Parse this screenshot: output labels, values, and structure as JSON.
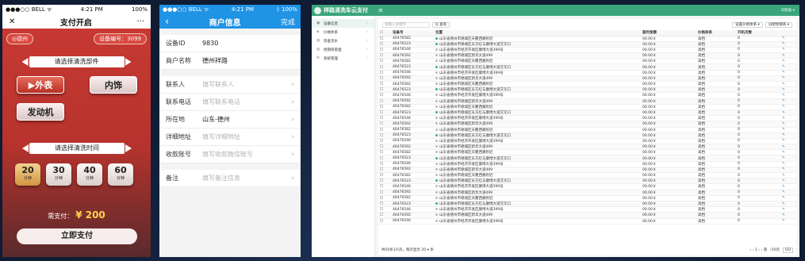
{
  "phone1": {
    "status": {
      "carrier": "●●●○○ BELL ᯤ",
      "time": "4:21 PM",
      "battery": "100%"
    },
    "nav": {
      "close": "✕",
      "title": "支付开启",
      "more": "···"
    },
    "location": "◎德州",
    "device_no": "设备编号：3099",
    "parts_title": "请选择清洗部件",
    "parts": [
      {
        "label": "外表",
        "active": true
      },
      {
        "label": "内饰",
        "active": false
      },
      {
        "label": "发动机",
        "active": false
      }
    ],
    "time_title": "请选择清洗时间",
    "times": [
      {
        "value": "20",
        "unit": "分钟",
        "active": true
      },
      {
        "value": "30",
        "unit": "分钟",
        "active": false
      },
      {
        "value": "40",
        "unit": "分钟",
        "active": false
      },
      {
        "value": "60",
        "unit": "分钟",
        "active": false
      }
    ],
    "pay_label": "需支付：",
    "pay_amount": "¥ 200",
    "pay_button": "立即支付"
  },
  "phone2": {
    "status": {
      "carrier": "●●●○○ BELL ᯤ",
      "time": "4:21 PM",
      "battery": "ᛒ 100%"
    },
    "nav": {
      "back": "‹",
      "title": "商户信息",
      "done": "完成"
    },
    "group1": [
      {
        "label": "设备ID",
        "value": "9830",
        "placeholder": false
      },
      {
        "label": "商户名称",
        "value": "德州祥路",
        "placeholder": false
      }
    ],
    "group2": [
      {
        "label": "联系人",
        "value": "填写联系人",
        "placeholder": true
      },
      {
        "label": "联系电话",
        "value": "填写联系电话",
        "placeholder": true
      },
      {
        "label": "所在地",
        "value": "山东-德州",
        "placeholder": false
      },
      {
        "label": "详细地址",
        "value": "填写详细地址",
        "placeholder": true
      },
      {
        "label": "收款账号",
        "value": "填写收款微信账号",
        "placeholder": true
      }
    ],
    "group3": [
      {
        "label": "备注",
        "value": "填写备注信息",
        "placeholder": true
      }
    ],
    "arrow": "›"
  },
  "admin": {
    "logo": "祥路清洗车云支付",
    "hamburger": "≡",
    "user": "日程表 ▾",
    "sidebar": [
      {
        "icon": "▣",
        "label": "设备信息",
        "active": true
      },
      {
        "icon": "◈",
        "label": "价格体系",
        "active": false
      },
      {
        "icon": "▤",
        "label": "资金流水",
        "active": false
      },
      {
        "icon": "▥",
        "label": "经销商管理",
        "active": false
      },
      {
        "icon": "⚙",
        "label": "系统管理",
        "active": false
      }
    ],
    "chevron": "›",
    "search_placeholder": "请输入关键字",
    "search_button": "Q 查询",
    "btn_right1": "设置价格体系 ▾",
    "btn_right2": "分配经销商 ▾",
    "columns": [
      "",
      "设备号",
      "位置",
      "盈利金额",
      "价格体系",
      "开机次数",
      ""
    ],
    "rows": [
      {
        "id": "46476582",
        "loc": "山东省德州市德城区天衢西路附近",
        "on": true,
        "amt": "00.00￥",
        "price": "高档",
        "count": "0"
      },
      {
        "id": "46476523",
        "loc": "山东省德州市德城区东方红与康博大道交叉口",
        "on": true,
        "amt": "00.00￥",
        "price": "高档",
        "count": "0"
      },
      {
        "id": "46476546",
        "loc": "山东省德州市经济开发区康博大道399号",
        "on": false,
        "amt": "00.00￥",
        "price": "高档",
        "count": "0"
      },
      {
        "id": "46476592",
        "loc": "山东省德州市德城区新华大道499",
        "on": false,
        "amt": "00.00￥",
        "price": "高档",
        "count": "0"
      },
      {
        "id": "46476582",
        "loc": "山东省德州市德城区天衢西路附近",
        "on": false,
        "amt": "00.00￥",
        "price": "高档",
        "count": "0"
      },
      {
        "id": "46476523",
        "loc": "山东省德州市德城区东方红与康博大道交叉口",
        "on": true,
        "amt": "00.00￥",
        "price": "高档",
        "count": "0"
      },
      {
        "id": "46476546",
        "loc": "山东省德州市经济开发区康博大道399号",
        "on": false,
        "amt": "00.00￥",
        "price": "高档",
        "count": "0"
      },
      {
        "id": "46476592",
        "loc": "山东省德州市德城区新华大道499",
        "on": false,
        "amt": "00.00￥",
        "price": "高档",
        "count": "0"
      },
      {
        "id": "46476582",
        "loc": "山东省德州市德城区天衢西路附近",
        "on": false,
        "amt": "00.00￥",
        "price": "高档",
        "count": "0"
      },
      {
        "id": "46476523",
        "loc": "山东省德州市德城区东方红与康博大道交叉口",
        "on": true,
        "amt": "00.00￥",
        "price": "高档",
        "count": "0"
      },
      {
        "id": "46476546",
        "loc": "山东省德州市经济开发区康博大道399号",
        "on": false,
        "amt": "00.00￥",
        "price": "高档",
        "count": "0"
      },
      {
        "id": "46476592",
        "loc": "山东省德州市德城区新华大道499",
        "on": false,
        "amt": "00.00￥",
        "price": "高档",
        "count": "0"
      },
      {
        "id": "46476582",
        "loc": "山东省德州市德城区天衢西路附近",
        "on": false,
        "amt": "00.00￥",
        "price": "高档",
        "count": "0"
      },
      {
        "id": "46476523",
        "loc": "山东省德州市德城区东方红与康博大道交叉口",
        "on": true,
        "amt": "00.00￥",
        "price": "高档",
        "count": "0"
      },
      {
        "id": "46476546",
        "loc": "山东省德州市经济开发区康博大道399号",
        "on": false,
        "amt": "00.00￥",
        "price": "高档",
        "count": "0"
      },
      {
        "id": "46476592",
        "loc": "山东省德州市德城区新华大道499",
        "on": false,
        "amt": "00.00￥",
        "price": "高档",
        "count": "0"
      },
      {
        "id": "46476582",
        "loc": "山东省德州市德城区天衢西路附近",
        "on": false,
        "amt": "00.00￥",
        "price": "高档",
        "count": "0"
      },
      {
        "id": "46476523",
        "loc": "山东省德州市德城区东方红与康博大道交叉口",
        "on": true,
        "amt": "00.00￥",
        "price": "高档",
        "count": "0"
      },
      {
        "id": "46476546",
        "loc": "山东省德州市经济开发区康博大道399号",
        "on": false,
        "amt": "00.00￥",
        "price": "高档",
        "count": "0"
      },
      {
        "id": "46476592",
        "loc": "山东省德州市德城区新华大道499",
        "on": false,
        "amt": "00.00￥",
        "price": "高档",
        "count": "0"
      },
      {
        "id": "46476582",
        "loc": "山东省德州市德城区天衢西路附近",
        "on": false,
        "amt": "00.00￥",
        "price": "高档",
        "count": "0"
      },
      {
        "id": "46476523",
        "loc": "山东省德州市德城区东方红与康博大道交叉口",
        "on": true,
        "amt": "00.00￥",
        "price": "高档",
        "count": "0"
      },
      {
        "id": "46476546",
        "loc": "山东省德州市经济开发区康博大道399号",
        "on": false,
        "amt": "00.00￥",
        "price": "高档",
        "count": "0"
      },
      {
        "id": "46476592",
        "loc": "山东省德州市德城区新华大道499",
        "on": false,
        "amt": "00.00￥",
        "price": "高档",
        "count": "0"
      },
      {
        "id": "46476582",
        "loc": "山东省德州市德城区天衢西路附近",
        "on": false,
        "amt": "00.00￥",
        "price": "高档",
        "count": "0"
      },
      {
        "id": "46476523",
        "loc": "山东省德州市德城区东方红与康博大道交叉口",
        "on": true,
        "amt": "00.00￥",
        "price": "高档",
        "count": "0"
      },
      {
        "id": "46476546",
        "loc": "山东省德州市经济开发区康博大道399号",
        "on": false,
        "amt": "00.00￥",
        "price": "高档",
        "count": "0"
      },
      {
        "id": "46476592",
        "loc": "山东省德州市德城区新华大道499",
        "on": false,
        "amt": "00.00￥",
        "price": "高档",
        "count": "0"
      },
      {
        "id": "46476582",
        "loc": "山东省德州市德城区天衢西路附近",
        "on": false,
        "amt": "00.00￥",
        "price": "高档",
        "count": "0"
      },
      {
        "id": "46476523",
        "loc": "山东省德州市德城区东方红与康博大道交叉口",
        "on": true,
        "amt": "00.00￥",
        "price": "高档",
        "count": "0"
      },
      {
        "id": "46476546",
        "loc": "山东省德州市经济开发区康博大道399号",
        "on": false,
        "amt": "00.00￥",
        "price": "高档",
        "count": "0"
      },
      {
        "id": "46476592",
        "loc": "山东省德州市德城区新华大道499",
        "on": false,
        "amt": "00.00￥",
        "price": "高档",
        "count": "0"
      },
      {
        "id": "46476546",
        "loc": "山东省德州市经济开发区康博大道399号",
        "on": false,
        "amt": "00.00￥",
        "price": "高档",
        "count": "0"
      }
    ],
    "edit_icon": "✎",
    "footer_left": "共50条1/5页，每页显示 20 ▾ 条",
    "footer_pages": "‹ ‹ 1 › › 第",
    "footer_total": "/10页",
    "go_button": "GO"
  }
}
